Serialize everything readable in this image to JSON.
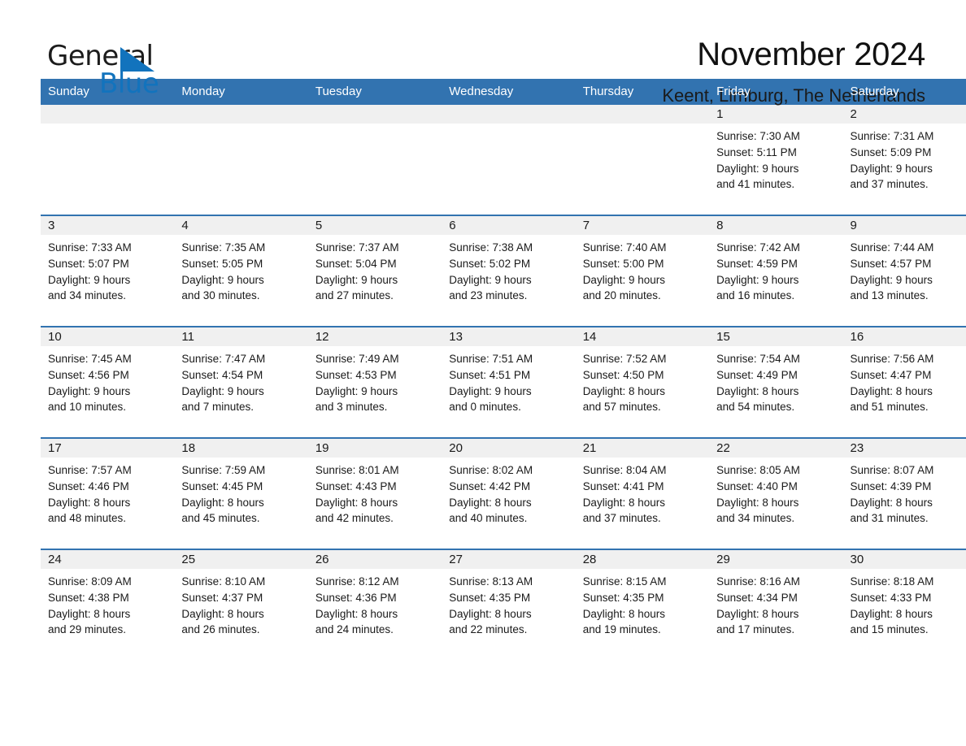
{
  "brand": {
    "name_part1": "General",
    "name_part2": "Blue",
    "accent_color": "#1273bd"
  },
  "header": {
    "title": "November 2024",
    "subtitle": "Keent, Limburg, The Netherlands",
    "header_bg_color": "#3273b0",
    "daynum_band_color": "#f0f0f0"
  },
  "weekdays": [
    "Sunday",
    "Monday",
    "Tuesday",
    "Wednesday",
    "Thursday",
    "Friday",
    "Saturday"
  ],
  "labels": {
    "sunrise_prefix": "Sunrise:",
    "sunset_prefix": "Sunset:",
    "daylight_prefix": "Daylight:"
  },
  "weeks": [
    [
      {
        "day": "",
        "sunrise": "",
        "sunset": "",
        "daylight_line1": "",
        "daylight_line2": "",
        "empty": true
      },
      {
        "day": "",
        "sunrise": "",
        "sunset": "",
        "daylight_line1": "",
        "daylight_line2": "",
        "empty": true
      },
      {
        "day": "",
        "sunrise": "",
        "sunset": "",
        "daylight_line1": "",
        "daylight_line2": "",
        "empty": true
      },
      {
        "day": "",
        "sunrise": "",
        "sunset": "",
        "daylight_line1": "",
        "daylight_line2": "",
        "empty": true
      },
      {
        "day": "",
        "sunrise": "",
        "sunset": "",
        "daylight_line1": "",
        "daylight_line2": "",
        "empty": true
      },
      {
        "day": "1",
        "sunrise": "Sunrise: 7:30 AM",
        "sunset": "Sunset: 5:11 PM",
        "daylight_line1": "Daylight: 9 hours",
        "daylight_line2": "and 41 minutes.",
        "empty": false
      },
      {
        "day": "2",
        "sunrise": "Sunrise: 7:31 AM",
        "sunset": "Sunset: 5:09 PM",
        "daylight_line1": "Daylight: 9 hours",
        "daylight_line2": "and 37 minutes.",
        "empty": false
      }
    ],
    [
      {
        "day": "3",
        "sunrise": "Sunrise: 7:33 AM",
        "sunset": "Sunset: 5:07 PM",
        "daylight_line1": "Daylight: 9 hours",
        "daylight_line2": "and 34 minutes.",
        "empty": false
      },
      {
        "day": "4",
        "sunrise": "Sunrise: 7:35 AM",
        "sunset": "Sunset: 5:05 PM",
        "daylight_line1": "Daylight: 9 hours",
        "daylight_line2": "and 30 minutes.",
        "empty": false
      },
      {
        "day": "5",
        "sunrise": "Sunrise: 7:37 AM",
        "sunset": "Sunset: 5:04 PM",
        "daylight_line1": "Daylight: 9 hours",
        "daylight_line2": "and 27 minutes.",
        "empty": false
      },
      {
        "day": "6",
        "sunrise": "Sunrise: 7:38 AM",
        "sunset": "Sunset: 5:02 PM",
        "daylight_line1": "Daylight: 9 hours",
        "daylight_line2": "and 23 minutes.",
        "empty": false
      },
      {
        "day": "7",
        "sunrise": "Sunrise: 7:40 AM",
        "sunset": "Sunset: 5:00 PM",
        "daylight_line1": "Daylight: 9 hours",
        "daylight_line2": "and 20 minutes.",
        "empty": false
      },
      {
        "day": "8",
        "sunrise": "Sunrise: 7:42 AM",
        "sunset": "Sunset: 4:59 PM",
        "daylight_line1": "Daylight: 9 hours",
        "daylight_line2": "and 16 minutes.",
        "empty": false
      },
      {
        "day": "9",
        "sunrise": "Sunrise: 7:44 AM",
        "sunset": "Sunset: 4:57 PM",
        "daylight_line1": "Daylight: 9 hours",
        "daylight_line2": "and 13 minutes.",
        "empty": false
      }
    ],
    [
      {
        "day": "10",
        "sunrise": "Sunrise: 7:45 AM",
        "sunset": "Sunset: 4:56 PM",
        "daylight_line1": "Daylight: 9 hours",
        "daylight_line2": "and 10 minutes.",
        "empty": false
      },
      {
        "day": "11",
        "sunrise": "Sunrise: 7:47 AM",
        "sunset": "Sunset: 4:54 PM",
        "daylight_line1": "Daylight: 9 hours",
        "daylight_line2": "and 7 minutes.",
        "empty": false
      },
      {
        "day": "12",
        "sunrise": "Sunrise: 7:49 AM",
        "sunset": "Sunset: 4:53 PM",
        "daylight_line1": "Daylight: 9 hours",
        "daylight_line2": "and 3 minutes.",
        "empty": false
      },
      {
        "day": "13",
        "sunrise": "Sunrise: 7:51 AM",
        "sunset": "Sunset: 4:51 PM",
        "daylight_line1": "Daylight: 9 hours",
        "daylight_line2": "and 0 minutes.",
        "empty": false
      },
      {
        "day": "14",
        "sunrise": "Sunrise: 7:52 AM",
        "sunset": "Sunset: 4:50 PM",
        "daylight_line1": "Daylight: 8 hours",
        "daylight_line2": "and 57 minutes.",
        "empty": false
      },
      {
        "day": "15",
        "sunrise": "Sunrise: 7:54 AM",
        "sunset": "Sunset: 4:49 PM",
        "daylight_line1": "Daylight: 8 hours",
        "daylight_line2": "and 54 minutes.",
        "empty": false
      },
      {
        "day": "16",
        "sunrise": "Sunrise: 7:56 AM",
        "sunset": "Sunset: 4:47 PM",
        "daylight_line1": "Daylight: 8 hours",
        "daylight_line2": "and 51 minutes.",
        "empty": false
      }
    ],
    [
      {
        "day": "17",
        "sunrise": "Sunrise: 7:57 AM",
        "sunset": "Sunset: 4:46 PM",
        "daylight_line1": "Daylight: 8 hours",
        "daylight_line2": "and 48 minutes.",
        "empty": false
      },
      {
        "day": "18",
        "sunrise": "Sunrise: 7:59 AM",
        "sunset": "Sunset: 4:45 PM",
        "daylight_line1": "Daylight: 8 hours",
        "daylight_line2": "and 45 minutes.",
        "empty": false
      },
      {
        "day": "19",
        "sunrise": "Sunrise: 8:01 AM",
        "sunset": "Sunset: 4:43 PM",
        "daylight_line1": "Daylight: 8 hours",
        "daylight_line2": "and 42 minutes.",
        "empty": false
      },
      {
        "day": "20",
        "sunrise": "Sunrise: 8:02 AM",
        "sunset": "Sunset: 4:42 PM",
        "daylight_line1": "Daylight: 8 hours",
        "daylight_line2": "and 40 minutes.",
        "empty": false
      },
      {
        "day": "21",
        "sunrise": "Sunrise: 8:04 AM",
        "sunset": "Sunset: 4:41 PM",
        "daylight_line1": "Daylight: 8 hours",
        "daylight_line2": "and 37 minutes.",
        "empty": false
      },
      {
        "day": "22",
        "sunrise": "Sunrise: 8:05 AM",
        "sunset": "Sunset: 4:40 PM",
        "daylight_line1": "Daylight: 8 hours",
        "daylight_line2": "and 34 minutes.",
        "empty": false
      },
      {
        "day": "23",
        "sunrise": "Sunrise: 8:07 AM",
        "sunset": "Sunset: 4:39 PM",
        "daylight_line1": "Daylight: 8 hours",
        "daylight_line2": "and 31 minutes.",
        "empty": false
      }
    ],
    [
      {
        "day": "24",
        "sunrise": "Sunrise: 8:09 AM",
        "sunset": "Sunset: 4:38 PM",
        "daylight_line1": "Daylight: 8 hours",
        "daylight_line2": "and 29 minutes.",
        "empty": false
      },
      {
        "day": "25",
        "sunrise": "Sunrise: 8:10 AM",
        "sunset": "Sunset: 4:37 PM",
        "daylight_line1": "Daylight: 8 hours",
        "daylight_line2": "and 26 minutes.",
        "empty": false
      },
      {
        "day": "26",
        "sunrise": "Sunrise: 8:12 AM",
        "sunset": "Sunset: 4:36 PM",
        "daylight_line1": "Daylight: 8 hours",
        "daylight_line2": "and 24 minutes.",
        "empty": false
      },
      {
        "day": "27",
        "sunrise": "Sunrise: 8:13 AM",
        "sunset": "Sunset: 4:35 PM",
        "daylight_line1": "Daylight: 8 hours",
        "daylight_line2": "and 22 minutes.",
        "empty": false
      },
      {
        "day": "28",
        "sunrise": "Sunrise: 8:15 AM",
        "sunset": "Sunset: 4:35 PM",
        "daylight_line1": "Daylight: 8 hours",
        "daylight_line2": "and 19 minutes.",
        "empty": false
      },
      {
        "day": "29",
        "sunrise": "Sunrise: 8:16 AM",
        "sunset": "Sunset: 4:34 PM",
        "daylight_line1": "Daylight: 8 hours",
        "daylight_line2": "and 17 minutes.",
        "empty": false
      },
      {
        "day": "30",
        "sunrise": "Sunrise: 8:18 AM",
        "sunset": "Sunset: 4:33 PM",
        "daylight_line1": "Daylight: 8 hours",
        "daylight_line2": "and 15 minutes.",
        "empty": false
      }
    ]
  ]
}
